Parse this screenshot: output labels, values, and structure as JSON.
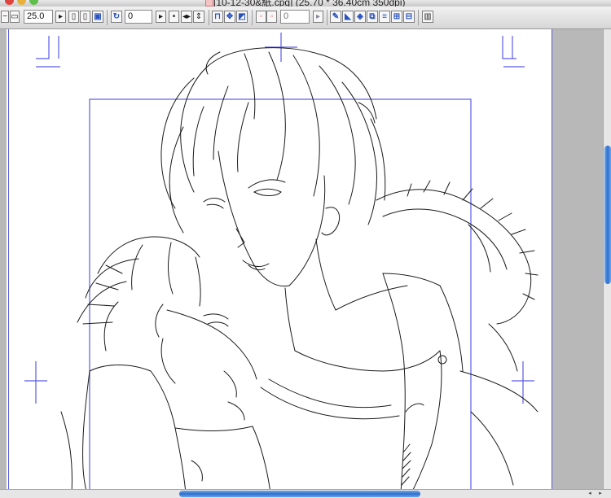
{
  "window": {
    "title": "[10-12-30&紙.cpg] (25.70 * 36.40cm 350dpi)"
  },
  "toolbar": {
    "zoom_value": "25.0",
    "rotation_value": "0",
    "opacity_value": "0"
  },
  "icons": {
    "zoom_out": "zoom-out-icon",
    "zoom_in": "zoom-in-icon",
    "rotate": "rotate-icon",
    "flip": "flip-icon",
    "ruler": "ruler-icon",
    "grid": "grid-icon",
    "layer": "layer-icon"
  },
  "colors": {
    "guide": "#5a5ae6",
    "scroll_thumb": "#2d6fd0",
    "line_art": "#1a1a1a"
  }
}
